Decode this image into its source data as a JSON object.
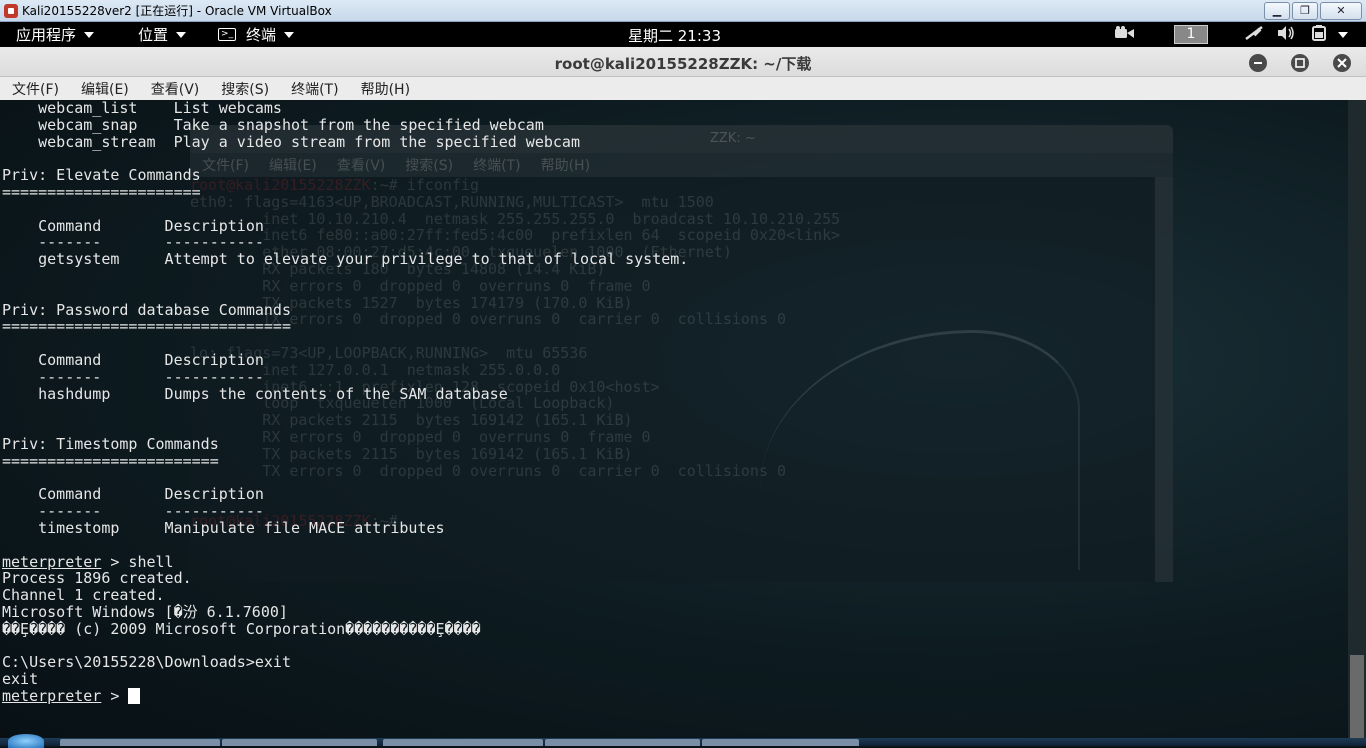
{
  "host": {
    "title": "Kali20155228ver2 [正在运行] - Oracle VM VirtualBox",
    "minimize": "▁",
    "maximize": "❐",
    "close": "✕"
  },
  "panel": {
    "applications": "应用程序",
    "places": "位置",
    "terminal": "终端",
    "terminal_glyph": ">_",
    "clock": "星期二 21:33",
    "workspace": "1"
  },
  "terminal": {
    "title": "root@kali20155228ZZK: ~/下载",
    "menu": [
      "文件(F)",
      "编辑(E)",
      "查看(V)",
      "搜索(S)",
      "终端(T)",
      "帮助(H)"
    ],
    "lines": [
      "    webcam_list    List webcams",
      "    webcam_snap    Take a snapshot from the specified webcam",
      "    webcam_stream  Play a video stream from the specified webcam",
      "",
      "Priv: Elevate Commands",
      "======================",
      "",
      "    Command       Description",
      "    -------       -----------",
      "    getsystem     Attempt to elevate your privilege to that of local system.",
      "",
      "",
      "Priv: Password database Commands",
      "================================",
      "",
      "    Command       Description",
      "    -------       -----------",
      "    hashdump      Dumps the contents of the SAM database",
      "",
      "",
      "Priv: Timestomp Commands",
      "========================",
      "",
      "    Command       Description",
      "    -------       -----------",
      "    timestomp     Manipulate file MACE attributes",
      ""
    ],
    "shell_prompt": "meterpreter",
    "shell_cmd": " > shell",
    "after_lines": [
      "Process 1896 created.",
      "Channel 1 created.",
      "Microsoft Windows [�汾 6.1.7600]",
      "��Ȩ���� (c) 2009 Microsoft Corporation����������Ȩ����",
      "",
      "C:\\Users\\20155228\\Downloads>exit",
      "exit"
    ],
    "final_prompt": "meterpreter",
    "final_suffix": " > "
  },
  "ghost": {
    "title": "ZZK: ~",
    "menu": [
      "文件(F)",
      "编辑(E)",
      "查看(V)",
      "搜索(S)",
      "终端(T)",
      "帮助(H)"
    ],
    "prompt1": "root@kali20155228ZZK",
    "cmd1": ":~# ifconfig",
    "lines": [
      "eth0: flags=4163<UP,BROADCAST,RUNNING,MULTICAST>  mtu 1500",
      "        inet 10.10.210.4  netmask 255.255.255.0  broadcast 10.10.210.255",
      "        inet6 fe80::a00:27ff:fed5:4c00  prefixlen 64  scopeid 0x20<link>",
      "        ether 08:00:27:d5:4c:00  txqueuelen 1000  (Ethernet)",
      "        RX packets 180  bytes 14808 (14.4 KiB)",
      "        RX errors 0  dropped 0  overruns 0  frame 0",
      "        TX packets 1527  bytes 174179 (170.0 KiB)",
      "        TX errors 0  dropped 0 overruns 0  carrier 0  collisions 0",
      "",
      "lo: flags=73<UP,LOOPBACK,RUNNING>  mtu 65536",
      "        inet 127.0.0.1  netmask 255.0.0.0",
      "        inet6 ::1  prefixlen 128  scopeid 0x10<host>",
      "        loop  txqueuelen 1000  (Local Loopback)",
      "        RX packets 2115  bytes 169142 (165.1 KiB)",
      "        RX errors 0  dropped 0  overruns 0  frame 0",
      "        TX packets 2115  bytes 169142 (165.1 KiB)",
      "        TX errors 0  dropped 0 overruns 0  carrier 0  collisions 0",
      "",
      ""
    ],
    "prompt2": "root@kali20155228ZZK",
    "cmd2": ":~# "
  }
}
